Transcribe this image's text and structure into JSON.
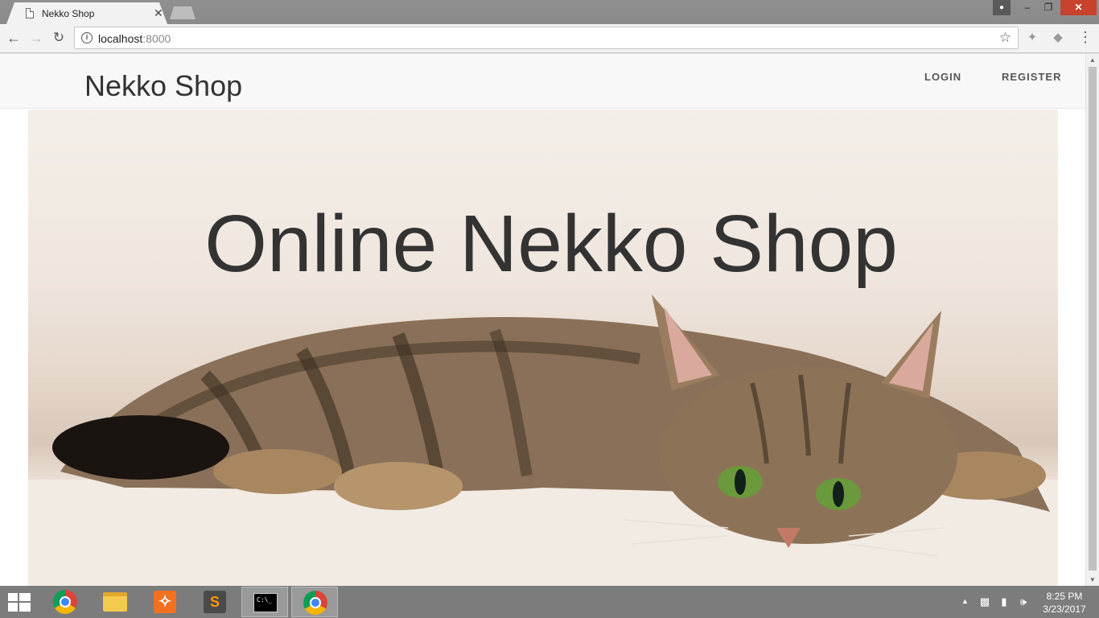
{
  "browser": {
    "tab_title": "Nekko Shop",
    "tab_close": "✕",
    "url_host": "localhost",
    "url_port": ":8000",
    "window_controls": {
      "minimize": "–",
      "maximize": "❐",
      "close": "✕"
    }
  },
  "site": {
    "brand": "Nekko Shop",
    "nav": {
      "login": "LOGIN",
      "register": "REGISTER"
    },
    "hero_title": "Online Nekko Shop",
    "hero_image": "tabby-cat-lying-photo"
  },
  "taskbar": {
    "apps": [
      "windows-start",
      "chrome",
      "file-explorer",
      "xampp",
      "sublime-text",
      "command-prompt",
      "chrome"
    ],
    "cmd_text": "C:\\_",
    "clock_time": "8:25 PM",
    "clock_date": "3/23/2017"
  },
  "colors": {
    "navbar_bg": "#f8f8f8",
    "brand_text": "#333333",
    "nav_text": "#555555",
    "taskbar_bg": "#7c7c7c",
    "close_button": "#c8432e"
  }
}
